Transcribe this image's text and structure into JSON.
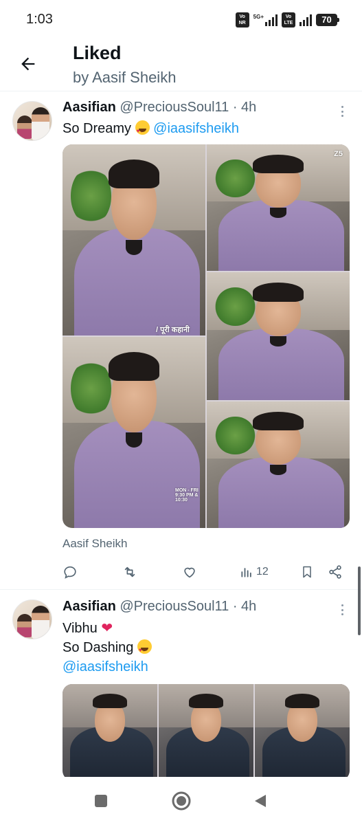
{
  "status_bar": {
    "time": "1:03",
    "net1": "Vo NR",
    "net2_tag": "5G+",
    "net3": "Vo LTE",
    "battery": "70"
  },
  "header": {
    "title": "Liked",
    "subtitle": "by Aasif Sheikh"
  },
  "tweets": [
    {
      "name": "Aasifian",
      "handle": "@PreciousSoul11 · 4h",
      "text_line1": "So Dreamy",
      "mention": "@iaasifsheikh",
      "media_caption": "Aasif Sheikh",
      "views": "12",
      "watermarks": [
        "Z5",
        "/ पूरी कहानी देखन",
        "MON - FRI 9:30 PM & 10:30"
      ]
    },
    {
      "name": "Aasifian",
      "handle": "@PreciousSoul11 · 4h",
      "text_line1": "Vibhu",
      "text_line2": "So Dashing",
      "mention": "@iaasifsheikh"
    }
  ],
  "colors": {
    "accent": "#1d9bf0",
    "secondary_text": "#536471",
    "heart": "#e0245e"
  },
  "icons": [
    "back-arrow-icon",
    "more-icon",
    "reply-icon",
    "retweet-icon",
    "like-icon",
    "views-icon",
    "bookmark-icon",
    "share-icon",
    "nav-recents-icon",
    "nav-home-icon",
    "nav-back-icon"
  ]
}
